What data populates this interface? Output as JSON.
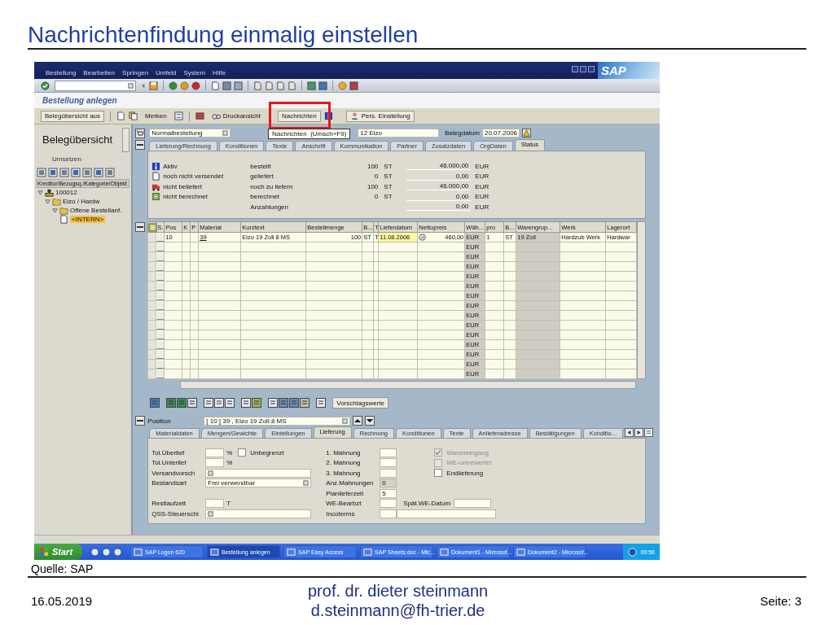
{
  "slide": {
    "title": "Nachrichtenfindung einmalig einstellen",
    "source": "Quelle: SAP",
    "date": "16.05.2019",
    "author": "prof. dr. dieter steinmann",
    "email": "d.steinmann@fh-trier.de",
    "page": "Seite: 3"
  },
  "sap": {
    "menu": [
      "Bestellung",
      "Bearbeiten",
      "Springen",
      "Umfeld",
      "System",
      "Hilfe"
    ],
    "logo": "SAP",
    "screen_title": "Bestellung anlegen",
    "app_buttons": [
      {
        "label": "Belegübersicht aus",
        "highlighted": false
      },
      {
        "label": "Merken",
        "highlighted": false
      },
      {
        "label": "Druckansicht",
        "highlighted": false
      },
      {
        "label": "Nachrichten",
        "highlighted": true
      },
      {
        "label": "Pers. Einstellung",
        "highlighted": false
      }
    ],
    "tooltip": "Nachrichten  (Umsch+F9)",
    "overview": {
      "title": "Belegübersicht",
      "action": "Umsetzen",
      "tree_header": "Kreditor/Bezugsq./Kategorie/Objekt",
      "tree": [
        {
          "label": "100012",
          "selected": false,
          "expanded": true,
          "children": [
            {
              "label": "Eizo / Hardw",
              "selected": false,
              "expanded": true,
              "children": [
                {
                  "label": "Offene Bestellanf.",
                  "selected": false,
                  "expanded": true,
                  "children": [
                    {
                      "label": "<INTERN>",
                      "selected": true
                    }
                  ]
                }
              ]
            }
          ]
        }
      ]
    },
    "header": {
      "doc_type": "Normalbestellung",
      "supplier": "12 Eizo",
      "date_label": "Belegdatum",
      "date": "20.07.2006"
    },
    "header_tabs": [
      {
        "label": "Lieferung/Rechnung",
        "selected": false
      },
      {
        "label": "Konditionen",
        "selected": false
      },
      {
        "label": "Texte",
        "selected": false
      },
      {
        "label": "Anschrift",
        "selected": false
      },
      {
        "label": "Kommunikation",
        "selected": false
      },
      {
        "label": "Partner",
        "selected": false
      },
      {
        "label": "Zusatzdaten",
        "selected": false
      },
      {
        "label": "OrgDaten",
        "selected": false
      },
      {
        "label": "Status",
        "selected": true
      }
    ],
    "status_rows": [
      {
        "status": "Aktiv",
        "label": "bestellt",
        "quantity": "100",
        "unit": "ST",
        "amount": "46.000,00",
        "currency": "EUR"
      },
      {
        "status": "noch nicht versendet",
        "label": "geliefert",
        "quantity": "0",
        "unit": "ST",
        "amount": "0,00",
        "currency": "EUR"
      },
      {
        "status": "nicht beliefert",
        "label": "noch zu liefern",
        "quantity": "100",
        "unit": "ST",
        "amount": "46.000,00",
        "currency": "EUR"
      },
      {
        "status": "nicht berechnet",
        "label": "berechnet",
        "quantity": "0",
        "unit": "ST",
        "amount": "0,00",
        "currency": "EUR"
      },
      {
        "label": "Anzahlungen",
        "amount": "0,00",
        "currency": "EUR"
      }
    ],
    "items": {
      "columns": [
        "S.",
        "Pos",
        "K",
        "P",
        "Material",
        "Kurztext",
        "Bestellmenge",
        "B...",
        "T",
        "Lieferdatum",
        "Nettopreis",
        "Wäh...",
        "pro",
        "B...",
        "Warengrup...",
        "Werk",
        "Lagerort"
      ],
      "rows": [
        {
          "cells": [
            null,
            "10",
            null,
            null,
            "39",
            "Eizo 19 Zoll 8 MS",
            "100",
            "ST",
            "T",
            {
              "text": "11.08.2006",
              "focused": true
            },
            "460,00",
            "EUR",
            "1",
            "ST",
            "19 Zoll",
            "Hardzub Werk",
            "Hardwar"
          ]
        },
        {
          "cells": [
            null,
            null,
            null,
            null,
            null,
            null,
            null,
            null,
            null,
            null,
            null,
            "EUR"
          ]
        },
        {
          "cells": [
            null,
            null,
            null,
            null,
            null,
            null,
            null,
            null,
            null,
            null,
            null,
            "EUR"
          ]
        },
        {
          "cells": [
            null,
            null,
            null,
            null,
            null,
            null,
            null,
            null,
            null,
            null,
            null,
            "EUR"
          ]
        },
        {
          "cells": [
            null,
            null,
            null,
            null,
            null,
            null,
            null,
            null,
            null,
            null,
            null,
            "EUR"
          ]
        },
        {
          "cells": [
            null,
            null,
            null,
            null,
            null,
            null,
            null,
            null,
            null,
            null,
            null,
            "EUR"
          ]
        },
        {
          "cells": [
            null,
            null,
            null,
            null,
            null,
            null,
            null,
            null,
            null,
            null,
            null,
            "EUR"
          ]
        },
        {
          "cells": [
            null,
            null,
            null,
            null,
            null,
            null,
            null,
            null,
            null,
            null,
            null,
            "EUR"
          ]
        },
        {
          "cells": [
            null,
            null,
            null,
            null,
            null,
            null,
            null,
            null,
            null,
            null,
            null,
            "EUR"
          ]
        },
        {
          "cells": [
            null,
            null,
            null,
            null,
            null,
            null,
            null,
            null,
            null,
            null,
            null,
            "EUR"
          ]
        },
        {
          "cells": [
            null,
            null,
            null,
            null,
            null,
            null,
            null,
            null,
            null,
            null,
            null,
            "EUR"
          ]
        },
        {
          "cells": [
            null,
            null,
            null,
            null,
            null,
            null,
            null,
            null,
            null,
            null,
            null,
            "EUR"
          ]
        },
        {
          "cells": [
            null,
            null,
            null,
            null,
            null,
            null,
            null,
            null,
            null,
            null,
            null,
            "EUR"
          ]
        },
        {
          "cells": [
            null,
            null,
            null,
            null,
            null,
            null,
            null,
            null,
            null,
            null,
            null,
            "EUR"
          ]
        },
        {
          "cells": [
            null,
            null,
            null,
            null,
            null,
            null,
            null,
            null,
            null,
            null,
            null,
            "EUR"
          ]
        }
      ]
    },
    "default_values_button": "Vorschlagswerte",
    "position": {
      "label": "Position",
      "value": "[ 10 ] 39 , Eizo 19 Zoll 8 MS"
    },
    "item_tabs": [
      {
        "label": "Materialdaten",
        "selected": false
      },
      {
        "label": "Mengen/Gewichte",
        "selected": false
      },
      {
        "label": "Einteilungen",
        "selected": false
      },
      {
        "label": "Lieferung",
        "selected": true
      },
      {
        "label": "Rechnung",
        "selected": false
      },
      {
        "label": "Konditionen",
        "selected": false
      },
      {
        "label": "Texte",
        "selected": false
      },
      {
        "label": "Anlieferadresse",
        "selected": false
      },
      {
        "label": "Bestätigungen",
        "selected": false
      },
      {
        "label": "Konditio...",
        "selected": false
      }
    ],
    "delivery": {
      "left": [
        {
          "label": "Tol.Überlief",
          "kind": "short",
          "unit": "%",
          "option": {
            "label": "Unbegrenzt",
            "checked": false
          }
        },
        {
          "label": "Tol.Unterlief",
          "kind": "short",
          "unit": "%"
        },
        {
          "label": "Versandvorsch",
          "kind": "dropdown"
        },
        {
          "label": "Bestandsart",
          "kind": "dropdown",
          "value": "Frei verwendbar"
        },
        {
          "label": "Restlaufzeit",
          "kind": "short",
          "unit": "T"
        },
        {
          "label": "QSS-Steuerschl",
          "kind": "dropdown"
        }
      ],
      "middle": [
        {
          "label": "1. Mahnung",
          "kind": "single",
          "disabled": false
        },
        {
          "label": "2. Mahnung",
          "kind": "single",
          "disabled": false
        },
        {
          "label": "3. Mahnung",
          "kind": "single",
          "disabled": false
        },
        {
          "label": "Anz.Mahnungen",
          "kind": "single",
          "value": "0",
          "disabled": true
        },
        {
          "label": "Planlieferzeit",
          "kind": "single",
          "value": "5",
          "disabled": false
        },
        {
          "label": "WE-Bearbzt",
          "kind": "single",
          "disabled": false,
          "extra": {
            "label": "Spät.WE-Datum"
          }
        },
        {
          "label": "Incoterms",
          "kind": "double",
          "disabled": false
        }
      ],
      "checks": [
        {
          "label": "Wareneingang",
          "checked": true,
          "disabled": true
        },
        {
          "label": "WE-unbewertet",
          "checked": false,
          "disabled": true
        },
        {
          "label": "Endlieferung",
          "checked": false,
          "disabled": false
        }
      ]
    },
    "taskbar": {
      "start": "Start",
      "tasks": [
        {
          "label": "SAP Logon 620",
          "selected": false
        },
        {
          "label": "Bestellung anlegen",
          "selected": true
        },
        {
          "label": "SAP Easy Access",
          "selected": false
        },
        {
          "label": "SAP Sheets.doc - Mic...",
          "selected": false
        },
        {
          "label": "Dokument1 - Microsof...",
          "selected": false
        },
        {
          "label": "Dokument2 - Microsof...",
          "selected": false
        }
      ],
      "clock": "09:56"
    }
  }
}
